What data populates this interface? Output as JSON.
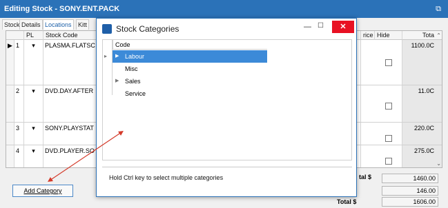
{
  "window": {
    "title": "Editing Stock - SONY.ENT.PACK",
    "restore_icon": "restore-icon"
  },
  "tabs": [
    "Stock",
    "Details",
    "Locations",
    "Kitt"
  ],
  "grid": {
    "headers": {
      "pl": "PL",
      "stock_code": "Stock Code",
      "price": "rice",
      "hide": "Hide",
      "total": "Tota"
    },
    "rows": [
      {
        "num": "1",
        "code": "PLASMA.FLATSC",
        "total": "1100.0C",
        "current": true
      },
      {
        "num": "2",
        "code": "DVD.DAY.AFTER",
        "total": "11.0C"
      },
      {
        "num": "3",
        "code": "SONY.PLAYSTAT",
        "total": "220.0C"
      },
      {
        "num": "4",
        "code": "DVD.PLAYER.SO",
        "total": "275.0C"
      }
    ]
  },
  "footer": {
    "add_category": "Add Category",
    "total_label": "tal $",
    "total_value": "1460.00",
    "second_value": "146.00",
    "grand_total_label": "Total $",
    "grand_total_value": "1606.00"
  },
  "dialog": {
    "title": "Stock Categories",
    "column": "Code",
    "items": [
      {
        "label": "Labour",
        "expandable": true,
        "selected": true
      },
      {
        "label": "Misc",
        "expandable": false,
        "selected": false
      },
      {
        "label": "Sales",
        "expandable": true,
        "selected": false
      },
      {
        "label": "Service",
        "expandable": false,
        "selected": false
      }
    ],
    "hint": "Hold Ctrl key to select multiple categories"
  },
  "colors": {
    "title_bar": "#2b72b8",
    "selection": "#3c8ad8",
    "close": "#e81123",
    "annotation_arrow": "#d43a2a"
  }
}
